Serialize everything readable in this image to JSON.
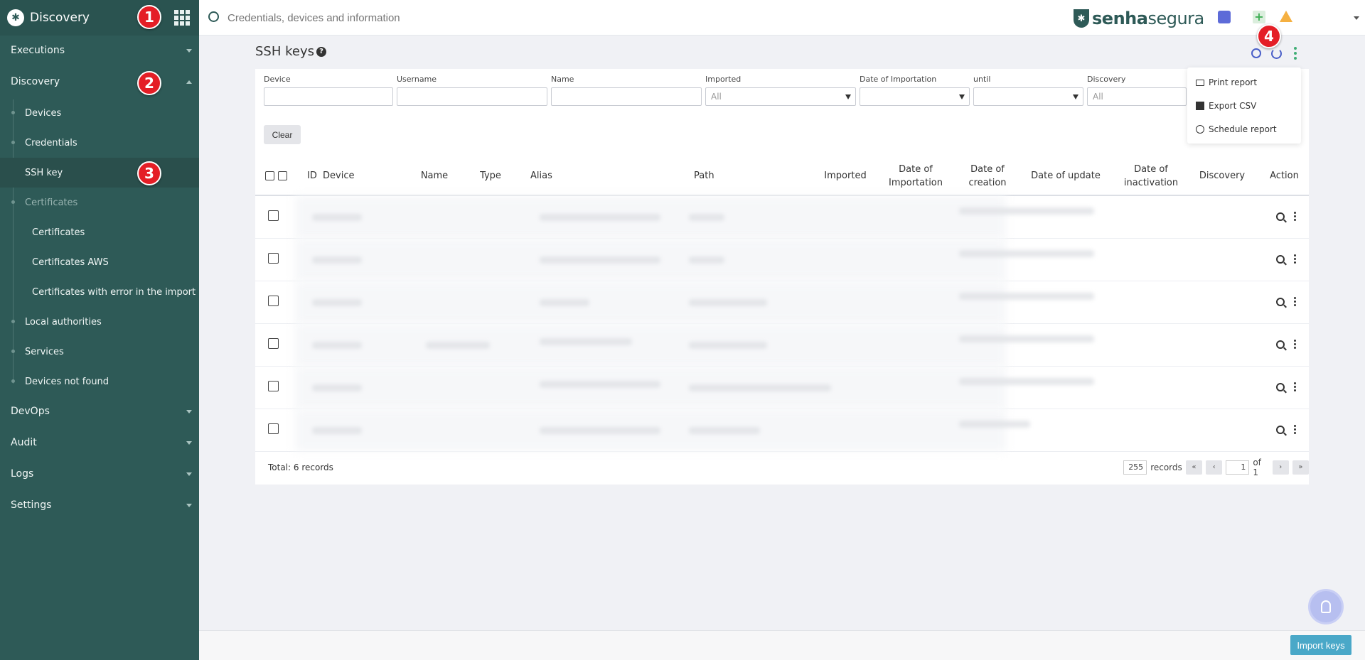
{
  "sidebar": {
    "title": "Discovery",
    "items": [
      {
        "label": "Executions"
      },
      {
        "label": "Discovery"
      },
      {
        "label": "DevOps"
      },
      {
        "label": "Audit"
      },
      {
        "label": "Logs"
      },
      {
        "label": "Settings"
      }
    ],
    "sub": [
      {
        "label": "Devices"
      },
      {
        "label": "Credentials"
      },
      {
        "label": "SSH key"
      },
      {
        "label": "Certificates"
      },
      {
        "label": "Local authorities"
      },
      {
        "label": "Services"
      },
      {
        "label": "Devices not found"
      }
    ],
    "certs": [
      {
        "label": "Certificates"
      },
      {
        "label": "Certificates AWS"
      },
      {
        "label": "Certificates with error in the import"
      }
    ]
  },
  "markers": [
    "1",
    "2",
    "3",
    "4"
  ],
  "topbar": {
    "search_placeholder": "Credentials, devices and information",
    "brand_a": "senha",
    "brand_b": "segura"
  },
  "page": {
    "title": "SSH keys"
  },
  "filters": {
    "device": "Device",
    "username": "Username",
    "name": "Name",
    "imported": "Imported",
    "imported_value": "All",
    "date_import": "Date of Importation",
    "until": "until",
    "discovery": "Discovery",
    "discovery_value": "All",
    "clear": "Clear"
  },
  "table": {
    "headers": {
      "id": "ID",
      "device": "Device",
      "name": "Name",
      "type": "Type",
      "alias": "Alias",
      "path": "Path",
      "imported": "Imported",
      "date_import": "Date of Importation",
      "date_creation": "Date of creation",
      "date_update": "Date of update",
      "date_inactivation": "Date of inactivation",
      "discovery": "Discovery",
      "action": "Action"
    },
    "total": "Total: 6 records"
  },
  "pager": {
    "per_page": "255",
    "records": "records",
    "first": "«",
    "prev": "‹",
    "page": "1",
    "of": "of 1",
    "next": "›",
    "last": "»"
  },
  "menu": {
    "print": "Print report",
    "csv": "Export CSV",
    "schedule": "Schedule report"
  },
  "footer": {
    "import": "Import keys"
  },
  "colors": {
    "sidebar": "#2e5a57",
    "accent": "#4aa8c8",
    "marker": "#e41e26"
  }
}
